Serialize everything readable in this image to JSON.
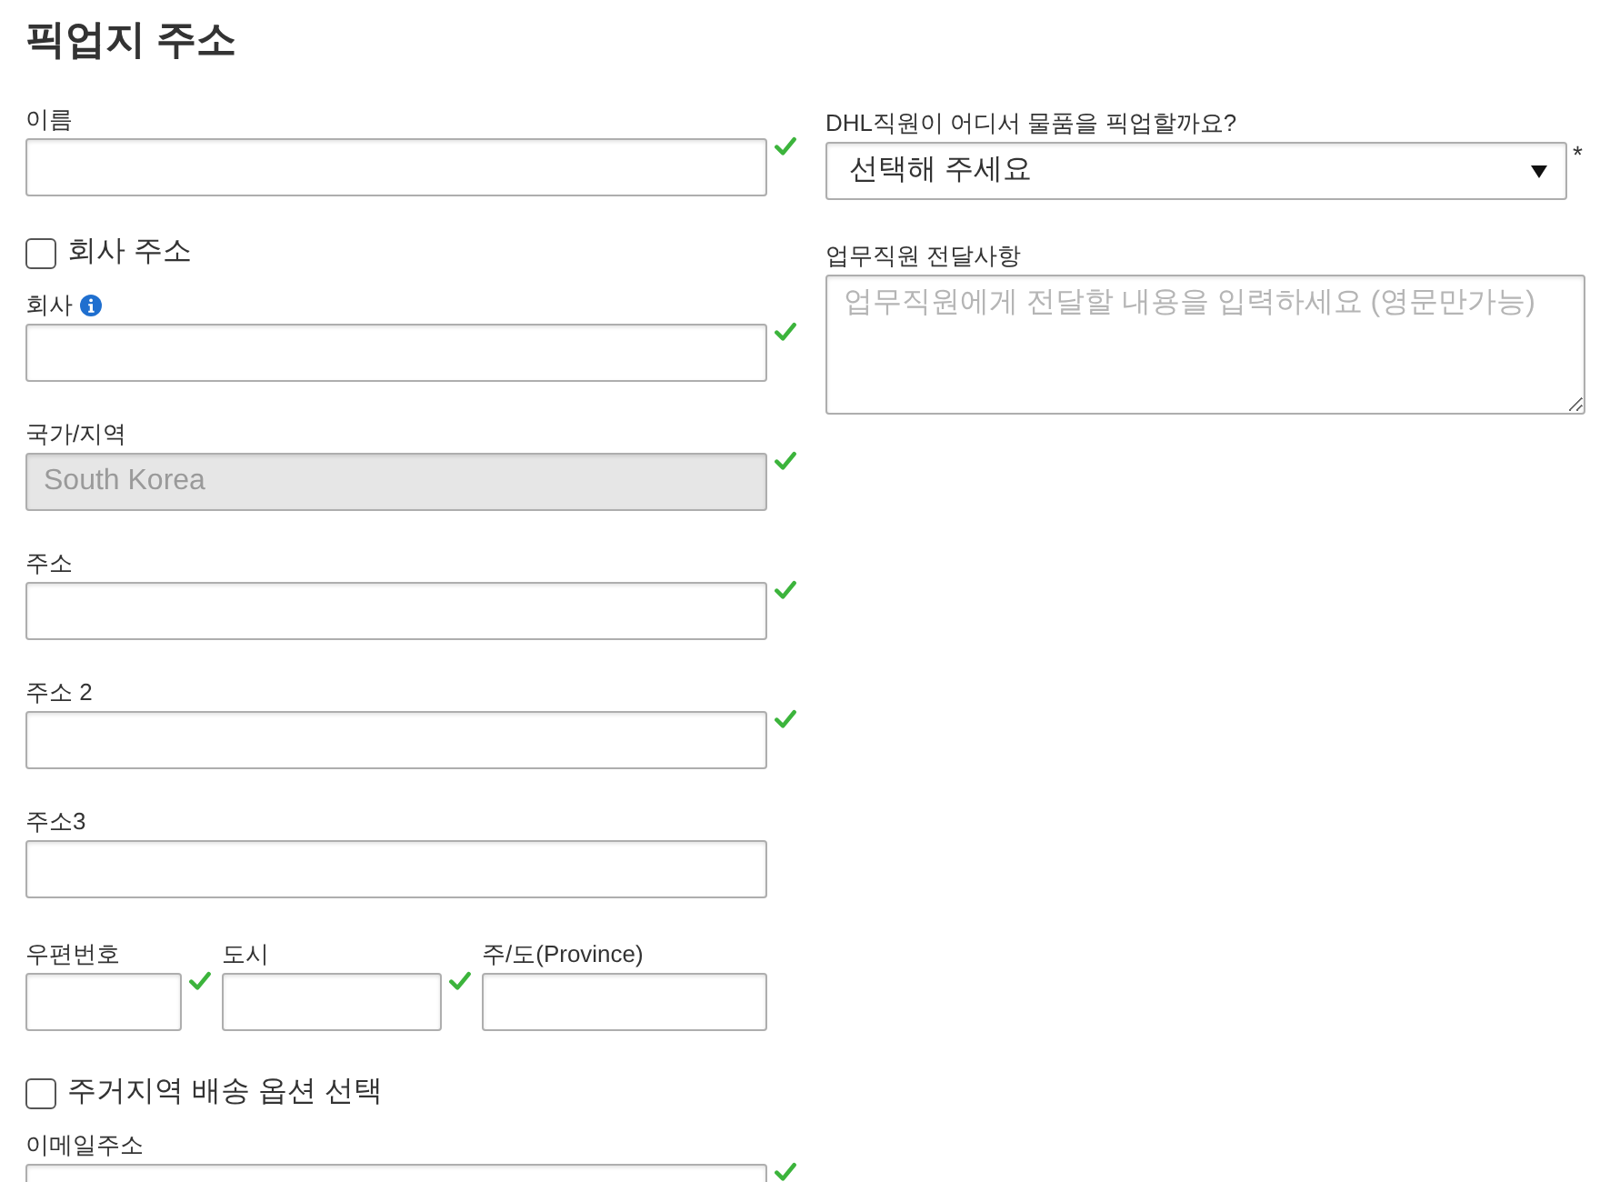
{
  "title": "픽업지 주소",
  "left_fields": [
    {
      "kind": "text",
      "label": "이름",
      "info": false,
      "disabled": false,
      "valid": true
    },
    {
      "kind": "checkbox",
      "label": "회사 주소",
      "checked": false
    },
    {
      "kind": "text",
      "label": "회사",
      "info": true,
      "disabled": false,
      "valid": true
    },
    {
      "kind": "text",
      "label": "국가/지역",
      "value": "South Korea",
      "info": false,
      "disabled": true,
      "valid": true
    },
    {
      "kind": "text",
      "label": "주소",
      "info": false,
      "disabled": false,
      "valid": true
    },
    {
      "kind": "text",
      "label": "주소 2",
      "info": false,
      "disabled": false,
      "valid": true
    },
    {
      "kind": "text",
      "label": "주소3",
      "info": false,
      "disabled": false,
      "valid": false
    },
    {
      "kind": "row",
      "fields": [
        {
          "label": "우편번호",
          "valid": true
        },
        {
          "label": "도시",
          "valid": true
        },
        {
          "label": "주/도(Province)",
          "valid": false
        }
      ]
    },
    {
      "kind": "checkbox",
      "label": "주거지역 배송 옵션 선택",
      "checked": false
    },
    {
      "kind": "text",
      "label": "이메일주소",
      "info": false,
      "disabled": false,
      "valid": true
    }
  ],
  "right_fields": [
    {
      "kind": "select",
      "label": "DHL직원이 어디서 물품을 픽업할까요?",
      "value": "선택해 주세요",
      "required_mark": "*"
    },
    {
      "kind": "textarea",
      "label": "업무직원 전달사항",
      "placeholder": "업무직원에게 전달할 내용을 입력하세요 (영문만가능)"
    }
  ]
}
